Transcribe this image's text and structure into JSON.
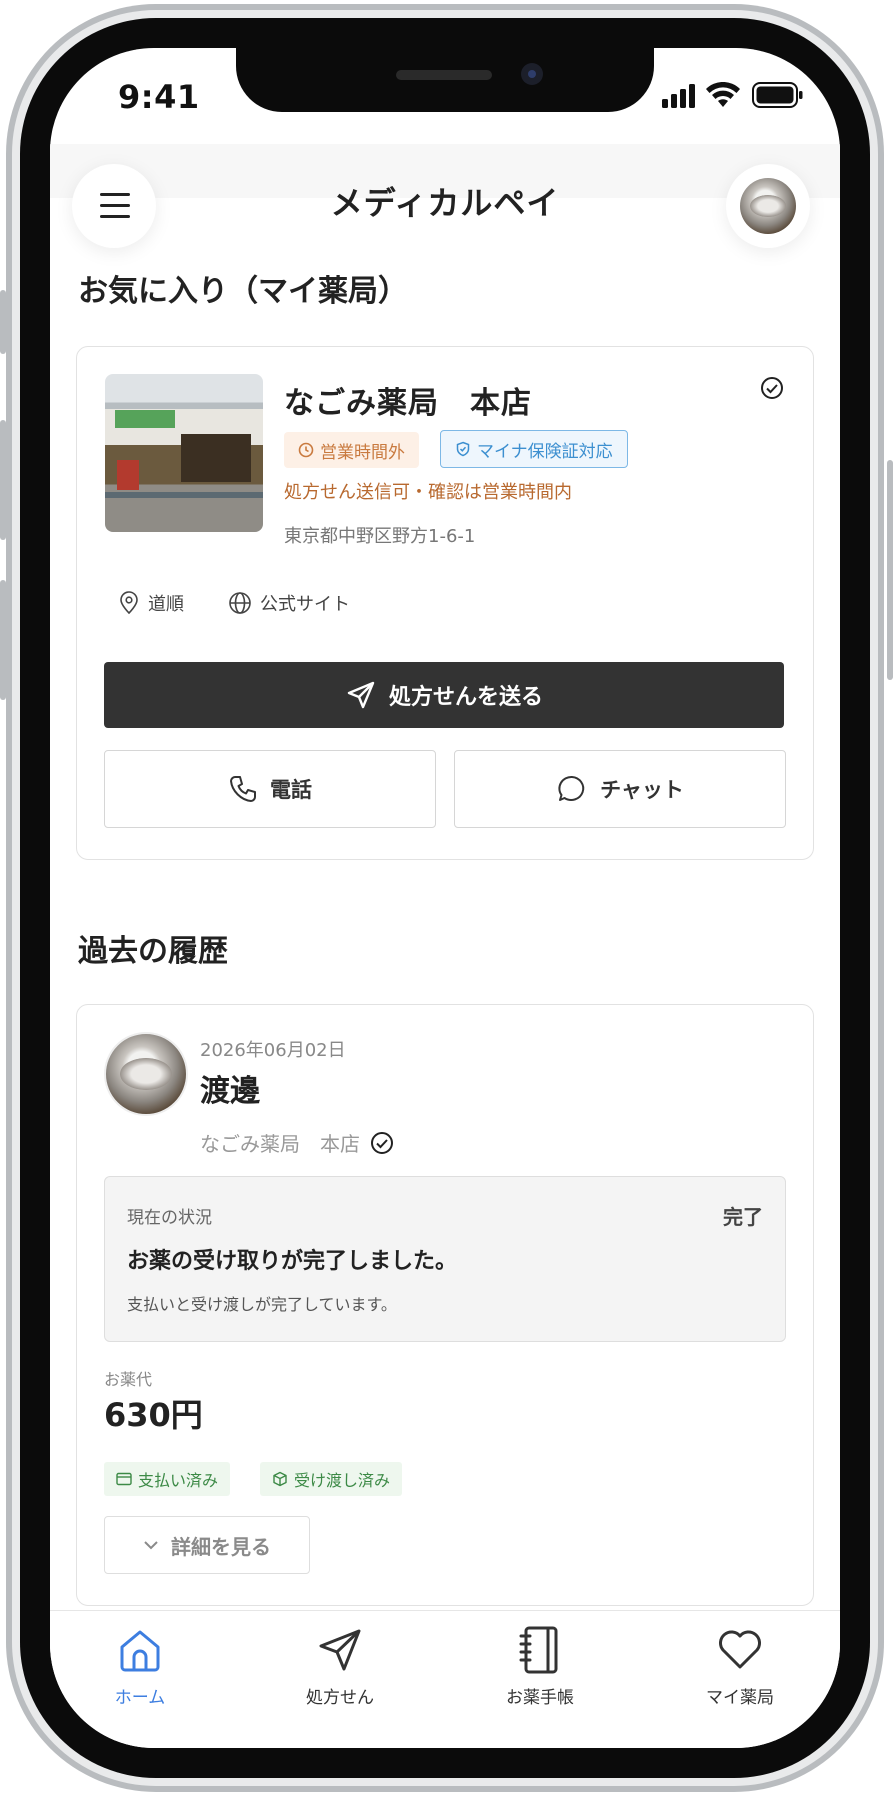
{
  "status_bar": {
    "time": "9:41"
  },
  "header": {
    "title": "メディカルペイ"
  },
  "favorites": {
    "heading": "お気に入り（マイ薬局）",
    "pharmacy": {
      "name": "なごみ薬局　本店",
      "tags": [
        "営業時間外",
        "マイナ保険証対応"
      ],
      "notice": "処方せん送信可・確認は営業時間内",
      "address": "東京都中野区野方1-6-1",
      "links": [
        "道順",
        "公式サイト"
      ],
      "primary_action": "処方せんを送る",
      "actions": [
        "電話",
        "チャット"
      ]
    }
  },
  "history": {
    "heading": "過去の履歴",
    "entry": {
      "date": "2026年06月02日",
      "patient_name": "渡邊",
      "pharmacy": "なごみ薬局　本店",
      "status": {
        "label": "現在の状況",
        "state": "完了",
        "title": "お薬の受け取りが完了しました。",
        "description": "支払いと受け渡しが完了しています。"
      },
      "fee_label": "お薬代",
      "fee_amount": "630円",
      "badges": [
        "支払い済み",
        "受け渡し済み"
      ],
      "details_button": "詳細を見る"
    }
  },
  "tab_bar": {
    "items": [
      {
        "label": "ホーム",
        "icon": "home-icon",
        "active": true
      },
      {
        "label": "処方せん",
        "icon": "send-icon",
        "active": false
      },
      {
        "label": "お薬手帳",
        "icon": "notebook-icon",
        "active": false
      },
      {
        "label": "マイ薬局",
        "icon": "heart-icon",
        "active": false
      }
    ]
  },
  "colors": {
    "accent": "#3d7ee0",
    "primary_button": "#333333",
    "warning": "#c97a3f",
    "info": "#3c8fd0",
    "success": "#3c8a46"
  }
}
